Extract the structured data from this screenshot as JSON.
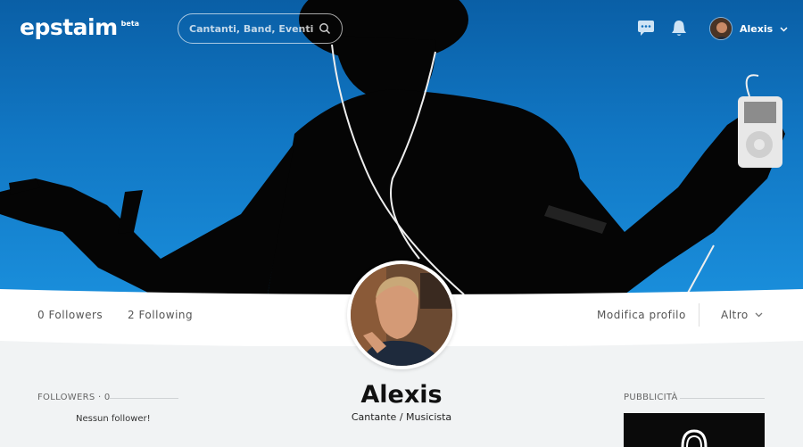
{
  "brand": {
    "logo": "epstaim",
    "badge": "beta"
  },
  "search": {
    "placeholder": "Cantanti, Band, Eventi..."
  },
  "nav": {
    "icons": [
      "chat-icon",
      "bell-icon"
    ],
    "user_name": "Alexis"
  },
  "stats": {
    "followers": "0 Followers",
    "following": "2 Following"
  },
  "actions": {
    "edit_profile": "Modifica profilo",
    "more": "Altro"
  },
  "profile": {
    "name": "Alexis",
    "role": "Cantante / Musicista"
  },
  "followers_section": {
    "title": "FOLLOWERS · 0",
    "empty": "Nessun follower!"
  },
  "ads_section": {
    "title": "PUBBLICITÀ"
  },
  "colors": {
    "cover_top": "#0a5fa6",
    "cover_bottom": "#1a8fdc",
    "background": "#f1f3f4",
    "text_dark": "#111111"
  }
}
